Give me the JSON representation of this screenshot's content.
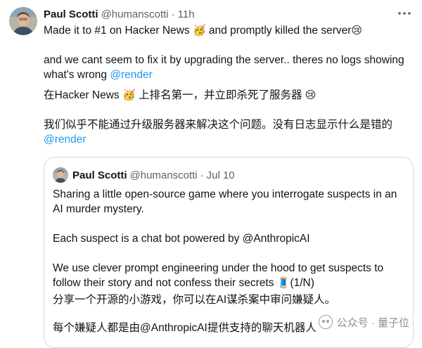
{
  "tweet": {
    "author_name": "Paul Scotti",
    "handle": "@humanscotti",
    "separator": "·",
    "time": "11h",
    "more_icon": "more-horizontal-icon",
    "lines": {
      "l1_text": "Made it to #1 on Hacker News ",
      "l1_emoji": "🥳",
      "l1_text2": " and promptly killed the server",
      "l1_emoji2": "😢",
      "l2_text": "and we cant seem to fix it by upgrading the server.. theres no logs showing what's wrong ",
      "l2_mention": "@render",
      "l3_text": "在Hacker News ",
      "l3_emoji": "🥳",
      "l3_text2": " 上排名第一，并立即杀死了服务器 ",
      "l3_emoji2": "😢",
      "l4_text": "我们似乎不能通过升级服务器来解决这个问题。没有日志显示什么是错的",
      "l4_mention": "@render"
    }
  },
  "quote": {
    "author_name": "Paul Scotti",
    "handle": "@humanscotti",
    "separator": "·",
    "date": "Jul 10",
    "lines": {
      "p1": "Sharing a little open-source game where you interrogate suspects in an AI murder mystery.",
      "p2": "Each suspect is a chat bot powered by @AnthropicAI",
      "p3_text": "We use clever prompt engineering under the hood to get suspects to follow their story and not confess their secrets ",
      "p3_emoji": "🧵",
      "p3_text2": "(1/N)",
      "p4": "分享一个开源的小游戏，你可以在AI谋杀案中审问嫌疑人。",
      "p5": "每个嫌疑人都是由@AnthropicAI提供支持的聊天机器人"
    }
  },
  "watermark": {
    "text": "公众号 · 量子位"
  },
  "colors": {
    "text": "#0f1419",
    "secondary": "#536471",
    "link": "#1d9bf0",
    "border": "#cfd9de"
  }
}
